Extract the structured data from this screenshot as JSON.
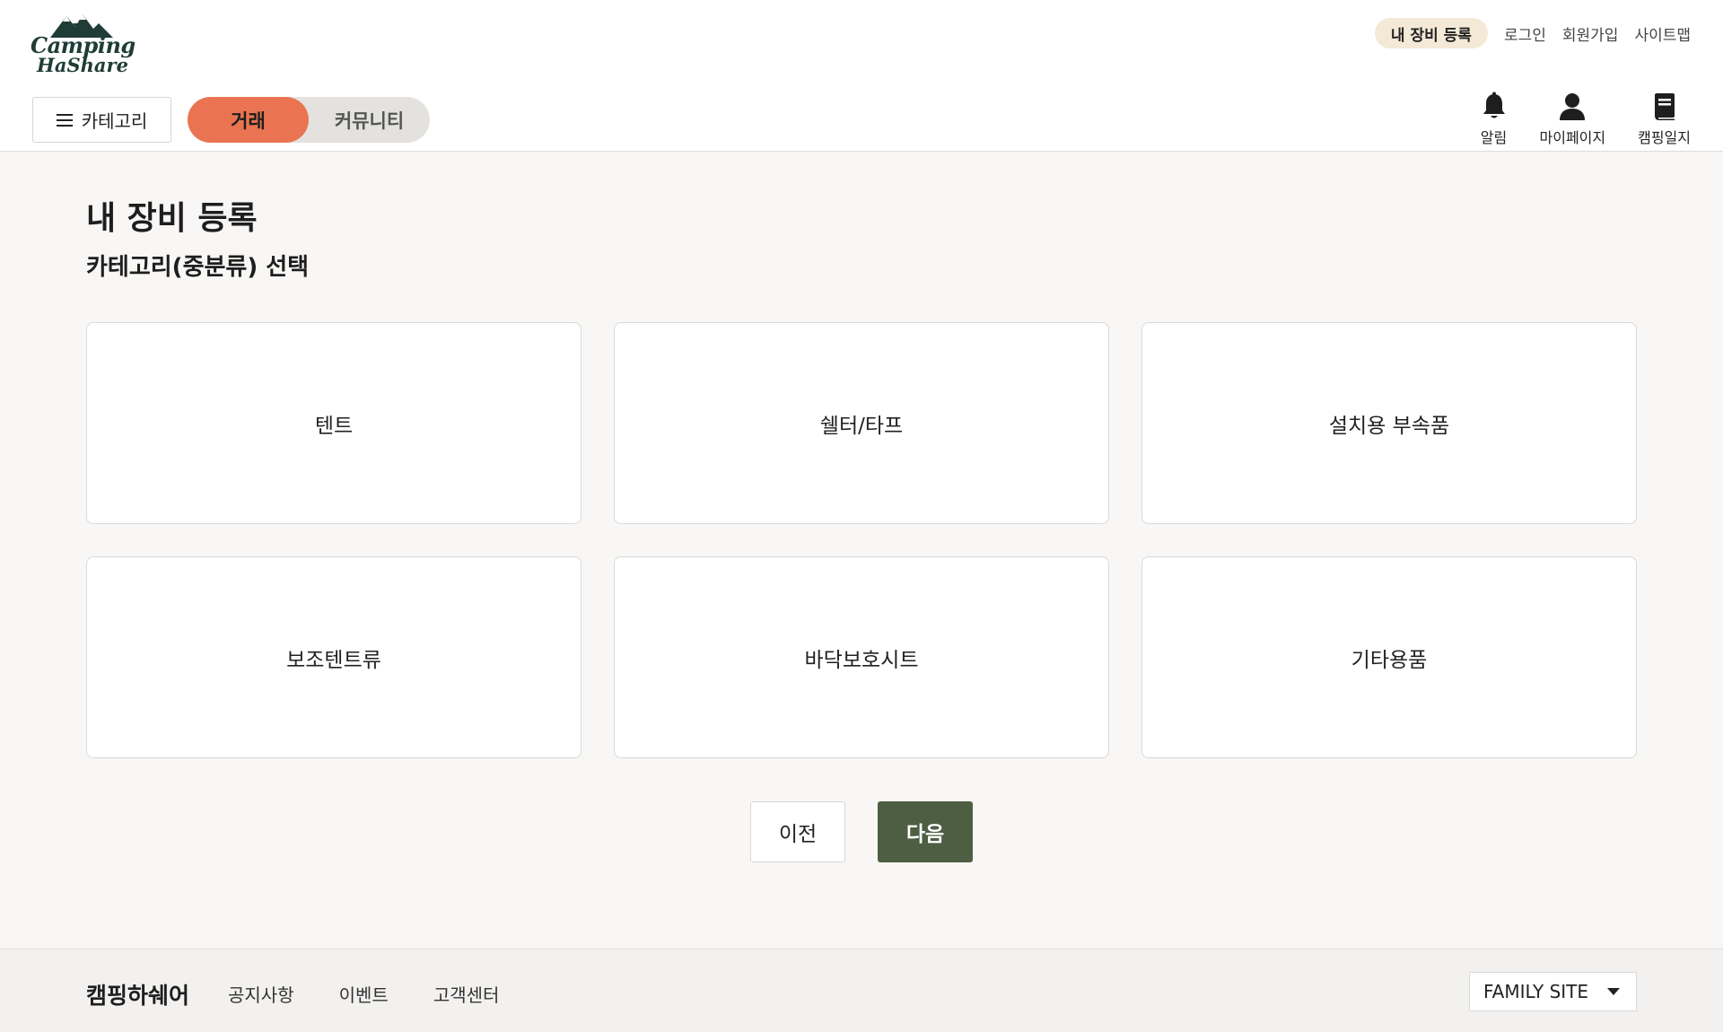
{
  "logo": {
    "line1": "Camping",
    "line2": "HaShare",
    "color": "#1f3d36"
  },
  "header": {
    "util_links": {
      "register_equipment": "내 장비 등록",
      "login": "로그인",
      "signup": "회원가입",
      "sitemap": "사이트맵"
    },
    "category_button": "카테고리",
    "mode_toggle": {
      "active": "거래",
      "inactive": "커뮤니티"
    },
    "icon_nav": [
      {
        "icon": "bell-icon",
        "label": "알림"
      },
      {
        "icon": "user-icon",
        "label": "마이페이지"
      },
      {
        "icon": "journal-icon",
        "label": "캠핑일지"
      }
    ]
  },
  "main": {
    "title": "내 장비 등록",
    "subtitle": "카테고리(중분류) 선택",
    "categories": [
      "텐트",
      "쉘터/타프",
      "설치용 부속품",
      "보조텐트류",
      "바닥보호시트",
      "기타용품"
    ],
    "prev_button": "이전",
    "next_button": "다음"
  },
  "footer": {
    "brand": "캠핑하쉐어",
    "links": [
      "공지사항",
      "이벤트",
      "고객센터"
    ],
    "family_site": "FAMILY SITE"
  },
  "colors": {
    "accent": "#ea7452",
    "primary_button": "#4d5e43",
    "badge": "#f4e9d6",
    "background": "#f8f7f5"
  }
}
